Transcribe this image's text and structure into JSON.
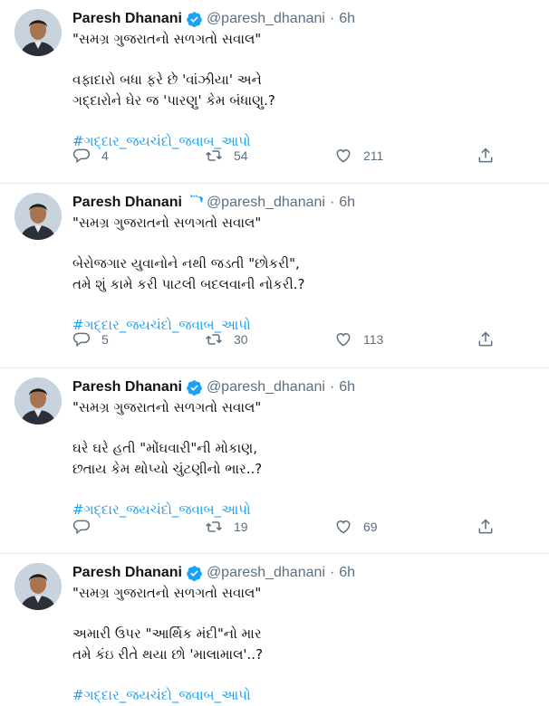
{
  "tweets": [
    {
      "name": "Paresh Dhanani",
      "handle": "@paresh_dhanani",
      "time": "6h",
      "title_line": "\"સમગ્ર ગુજરાતનો સળગતો સવાલ\"",
      "lines": [
        "વફાદારો બધા ફરે છે 'વાંઝીયા' અને",
        "ગદ્દારોને ઘેર જ 'પારણુ' કેમ બંધાણુ.?"
      ],
      "hashtag": "#ગદ્દાર_જયચંદો_જવાબ_આપો",
      "replies": "4",
      "retweets": "54",
      "likes": "211"
    },
    {
      "name": "Paresh Dhanani",
      "handle": "@paresh_dhanani",
      "time": "6h",
      "title_line": "\"સમગ્ર ગુજરાતનો સળગતો સવાલ\"",
      "lines": [
        "બેરોજગાર યુવાનોને નથી જડતી \"છોકરી\",",
        "તમે શું કામે કરી પાટલી બદલવાની નોકરી.?"
      ],
      "hashtag": "#ગદ્દાર_જયચંદો_જવાબ_આપો",
      "replies": "5",
      "retweets": "30",
      "likes": "113"
    },
    {
      "name": "Paresh Dhanani",
      "handle": "@paresh_dhanani",
      "time": "6h",
      "title_line": "\"સમગ્ર ગુજરાતનો સળગતો સવાલ\"",
      "lines": [
        "ઘરે ઘરે હતી \"મોંઘવારી\"ની મોકાણ,",
        "છતાય કેમ થોપ્યો ચુંટણીનો ભાર..?"
      ],
      "hashtag": "#ગદ્દાર_જયચંદો_જવાબ_આપો",
      "replies": "",
      "retweets": "19",
      "likes": "69"
    },
    {
      "name": "Paresh Dhanani",
      "handle": "@paresh_dhanani",
      "time": "6h",
      "title_line": "\"સમગ્ર ગુજરાતનો સળગતો સવાલ\"",
      "lines": [
        "અમારી ઉપર \"આર્થિક મંદી\"નો માર",
        "તમે કંઇ રીતે થયા છો 'માલામાલ'..?"
      ],
      "hashtag": "#ગદ્દાર_જયચંદો_જવાબ_આપો"
    }
  ],
  "icons": {
    "verified": "verified-badge-icon",
    "reply": "reply-icon",
    "retweet": "retweet-icon",
    "like": "heart-icon",
    "share": "share-icon"
  },
  "colors": {
    "accent": "#1da1f2",
    "muted": "#5b7083",
    "border": "#e6ecf0"
  }
}
